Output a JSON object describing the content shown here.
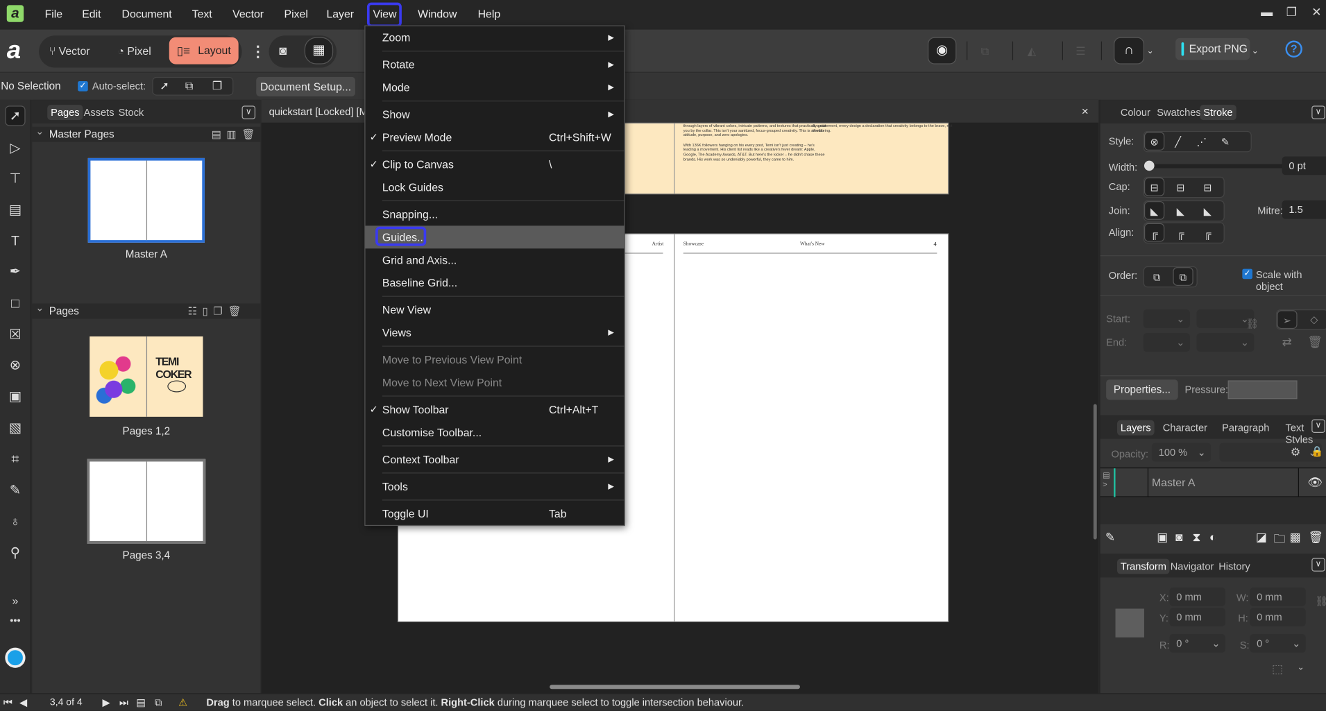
{
  "menubar": {
    "items": [
      "File",
      "Edit",
      "Document",
      "Text",
      "Vector",
      "Pixel",
      "Layer",
      "View",
      "Window",
      "Help"
    ],
    "active": "View"
  },
  "toolbar": {
    "personas": {
      "vector": "Vector",
      "pixel": "Pixel",
      "layout": "Layout"
    },
    "active_persona": "Layout",
    "export_label": "Export PNG"
  },
  "context": {
    "selection": "No Selection",
    "autoselect_label": "Auto-select:",
    "autoselect_checked": true,
    "document_setup": "Document Setup..."
  },
  "left_panel": {
    "tabs": [
      "Pages",
      "Assets",
      "Stock"
    ],
    "active_tab": "Pages",
    "master_header": "Master Pages",
    "pages_header": "Pages",
    "masters": [
      {
        "label": "Master A"
      }
    ],
    "pages": [
      {
        "label": "Pages 1,2"
      },
      {
        "label": "Pages 3,4"
      }
    ],
    "thumb_title": "TEMI COKER"
  },
  "document": {
    "tab_title": "quickstart [Locked] [Mo",
    "close": "×",
    "top_page_text": [
      "through layers of vibrant colors, intricate patterns, and textures that practically grab you by the collar. This isn't your sanitized, focus-grouped creativity. This is art with attitude, purpose, and zero apologies.",
      "With 136K followers hanging on his every post, Temi isn't just creating – he's leading a movement. His client list reads like a creative's fever dream: Apple, Google, The Academy Awards, AT&T. But here's the kicker – he didn't chase these brands. His work was so undeniably powerful, they came to him.",
      "is a statement, every design a declaration that creativity belongs to the brave, not the boring."
    ],
    "header_left": "Artist",
    "header_showcase": "Showcase",
    "header_center": "What's New",
    "page_number": "4"
  },
  "view_menu": [
    {
      "label": "Zoom",
      "submenu": true
    },
    {
      "sep": true
    },
    {
      "label": "Rotate",
      "submenu": true
    },
    {
      "label": "Mode",
      "submenu": true
    },
    {
      "sep": true
    },
    {
      "label": "Show",
      "submenu": true
    },
    {
      "label": "Preview Mode",
      "checked": true,
      "shortcut": "Ctrl+Shift+W"
    },
    {
      "sep": true
    },
    {
      "label": "Clip to Canvas",
      "checked": true,
      "shortcut": "\\"
    },
    {
      "label": "Lock Guides"
    },
    {
      "sep": true
    },
    {
      "label": "Snapping..."
    },
    {
      "label": "Guides...",
      "highlighted": true
    },
    {
      "label": "Grid and Axis..."
    },
    {
      "label": "Baseline Grid..."
    },
    {
      "sep": true
    },
    {
      "label": "New View"
    },
    {
      "label": "Views",
      "submenu": true
    },
    {
      "sep": true
    },
    {
      "label": "Move to Previous View Point",
      "disabled": true
    },
    {
      "label": "Move to Next View Point",
      "disabled": true
    },
    {
      "sep": true
    },
    {
      "label": "Show Toolbar",
      "checked": true,
      "shortcut": "Ctrl+Alt+T"
    },
    {
      "label": "Customise Toolbar..."
    },
    {
      "sep": true
    },
    {
      "label": "Context Toolbar",
      "submenu": true
    },
    {
      "sep": true
    },
    {
      "label": "Tools",
      "submenu": true
    },
    {
      "sep": true
    },
    {
      "label": "Toggle UI",
      "shortcut": "Tab"
    }
  ],
  "stroke_panel": {
    "tabs": [
      "Colour",
      "Swatches",
      "Stroke"
    ],
    "active_tab": "Stroke",
    "style_label": "Style:",
    "width_label": "Width:",
    "width_value": "0 pt",
    "width_fraction": 0,
    "cap_label": "Cap:",
    "join_label": "Join:",
    "mitre_label": "Mitre:",
    "mitre_value": "1.5",
    "align_label": "Align:",
    "order_label": "Order:",
    "scale_label": "Scale with object",
    "scale_checked": true,
    "start_label": "Start:",
    "end_label": "End:",
    "properties_label": "Properties...",
    "pressure_label": "Pressure:"
  },
  "layers_panel": {
    "tabs": [
      "Layers",
      "Character",
      "Paragraph",
      "Text Styles"
    ],
    "active_tab": "Layers",
    "opacity_label": "Opacity:",
    "opacity_value": "100 %",
    "layer_name": "Master A"
  },
  "transform_panel": {
    "tabs": [
      "Transform",
      "Navigator",
      "History"
    ],
    "active_tab": "Transform",
    "x_label": "X:",
    "x_value": "0 mm",
    "y_label": "Y:",
    "y_value": "0 mm",
    "w_label": "W:",
    "w_value": "0 mm",
    "h_label": "H:",
    "h_value": "0 mm",
    "r_label": "R:",
    "r_value": "0 °",
    "s_label": "S:",
    "s_value": "0 °"
  },
  "statusbar": {
    "page_indicator": "3,4 of 4",
    "hint_parts": [
      {
        "text": "Drag",
        "bold": true
      },
      {
        "text": " to marquee select. ",
        "bold": false
      },
      {
        "text": "Click",
        "bold": true
      },
      {
        "text": " an object to select it. ",
        "bold": false
      },
      {
        "text": "Right-Click",
        "bold": true
      },
      {
        "text": " during marquee select to toggle intersection behaviour.",
        "bold": false
      }
    ]
  },
  "colors": {
    "accent_layout": "#f28c76",
    "highlight_outline": "#3a3af0",
    "export_accent": "#2ee0f0",
    "checkbox": "#1f77d0",
    "layer_marker": "#20c0a0",
    "top_page": "#fde8c0"
  }
}
